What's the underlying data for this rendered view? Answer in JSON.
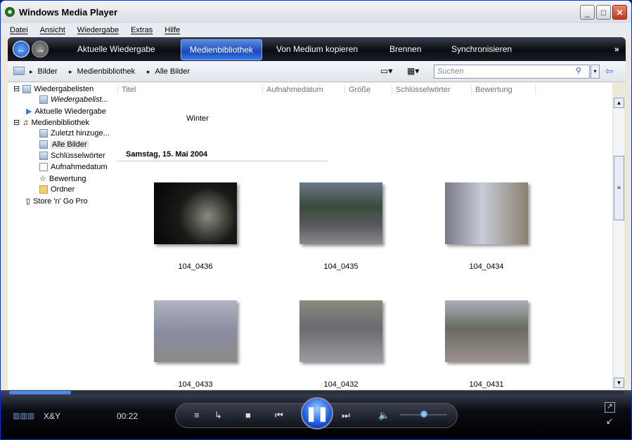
{
  "window": {
    "title": "Windows Media Player"
  },
  "menu": [
    "Datei",
    "Ansicht",
    "Wiedergabe",
    "Extras",
    "Hilfe"
  ],
  "nav": {
    "tabs": [
      "Aktuelle Wiedergabe",
      "Medienbibliothek",
      "Von Medium kopieren",
      "Brennen",
      "Synchronisieren"
    ],
    "active": "Medienbibliothek",
    "more": "»"
  },
  "breadcrumb": [
    "Bilder",
    "Medienbibliothek",
    "Alle Bilder"
  ],
  "search": {
    "placeholder": "Suchen"
  },
  "tree": {
    "playlists": "Wiedergabelisten",
    "new_playlist": "Wiedergabelist...",
    "now_playing": "Aktuelle Wiedergabe",
    "library": "Medienbibliothek",
    "recent": "Zuletzt hinzuge...",
    "all_pictures": "Alle Bilder",
    "keywords": "Schlüsselwörter",
    "date_taken": "Aufnahmedatum",
    "rating": "Bewertung",
    "folder": "Ordner",
    "device": "Store 'n' Go Pro"
  },
  "columns": [
    "Titel",
    "Aufnahmedatum",
    "Größe",
    "Schlüsselwörter",
    "Bewertung"
  ],
  "group_prev": "Winter",
  "group": "Samstag, 15. Mai 2004",
  "photos": [
    "104_0436",
    "104_0435",
    "104_0434",
    "104_0433",
    "104_0432",
    "104_0431"
  ],
  "player": {
    "track": "X&Y",
    "time": "00:22",
    "progress": 0.1,
    "volume": 0.5
  }
}
